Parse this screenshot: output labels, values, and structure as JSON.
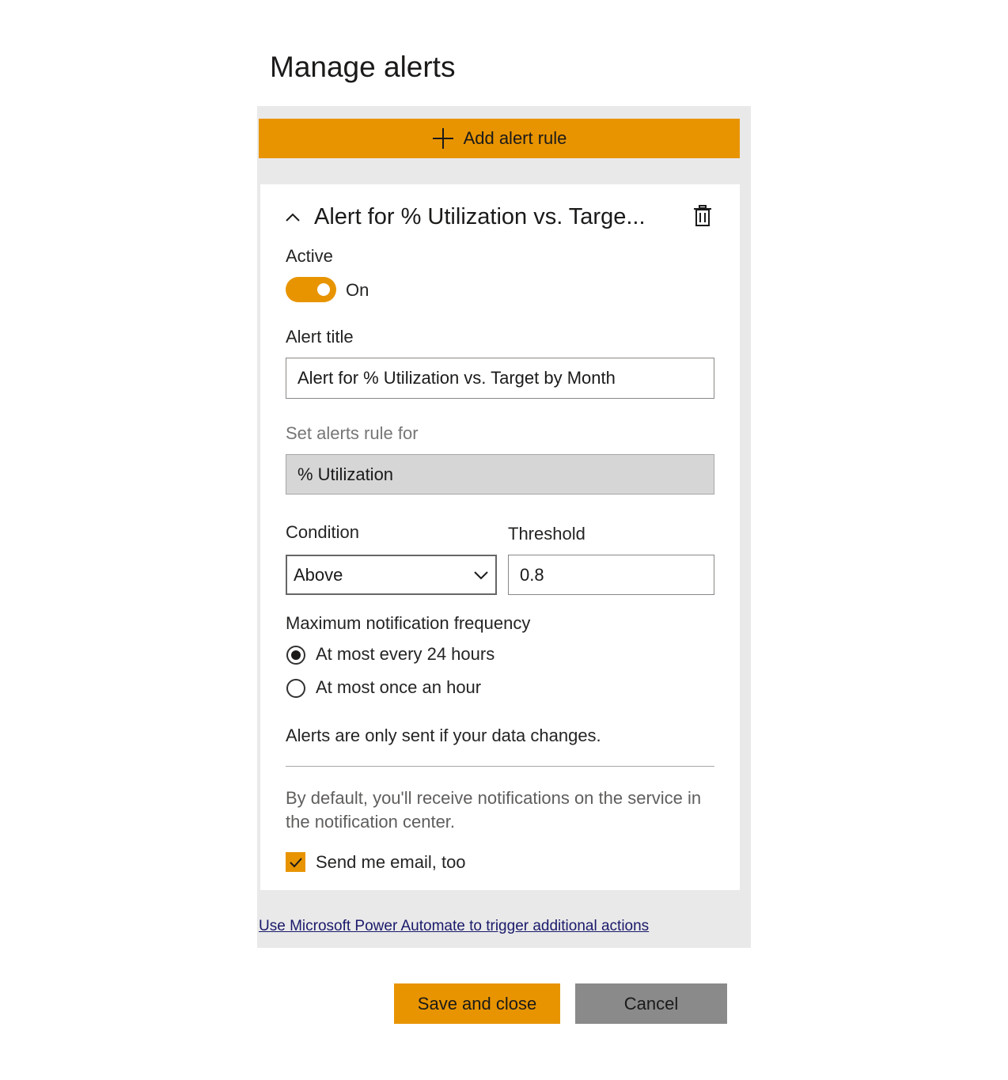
{
  "dialog": {
    "title": "Manage alerts",
    "add_rule_label": "Add alert rule",
    "accent_color": "#e89400"
  },
  "rule": {
    "header": "Alert for % Utilization vs. Targe...",
    "active_label": "Active",
    "active_state": "On",
    "alert_title_label": "Alert title",
    "alert_title_value": "Alert for % Utilization vs. Target by Month",
    "set_for_label": "Set alerts rule for",
    "set_for_value": "% Utilization",
    "condition_label": "Condition",
    "condition_value": "Above",
    "threshold_label": "Threshold",
    "threshold_value": "0.8",
    "frequency_label": "Maximum notification frequency",
    "frequency_options": [
      "At most every 24 hours",
      "At most once an hour"
    ],
    "frequency_selected": "At most every 24 hours",
    "data_change_note": "Alerts are only sent if your data changes.",
    "default_note": "By default, you'll receive notifications on the service in the notification center.",
    "email_label": "Send me email, too",
    "email_checked": true
  },
  "footer": {
    "automate_link": "Use Microsoft Power Automate to trigger additional actions",
    "save_label": "Save and close",
    "cancel_label": "Cancel"
  },
  "icons": [
    "plus-icon",
    "chevron-up-icon",
    "trash-icon",
    "chevron-down-icon",
    "checkmark-icon"
  ]
}
